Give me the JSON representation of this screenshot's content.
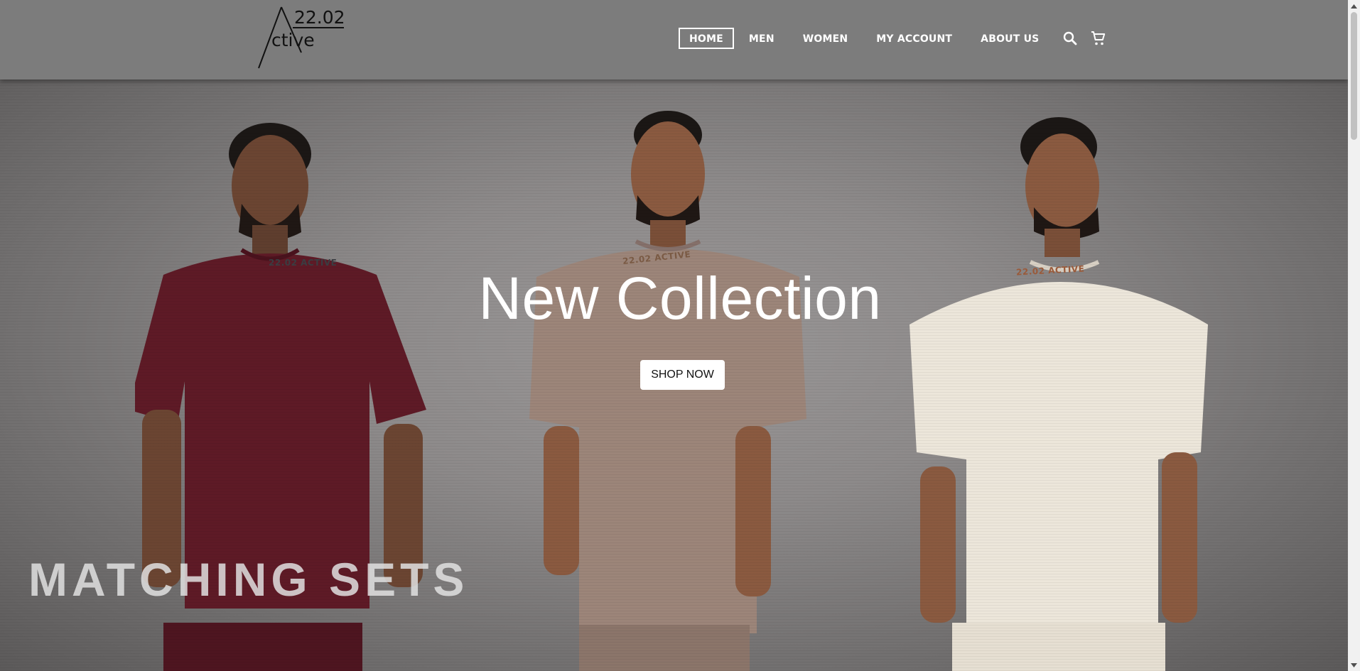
{
  "brand": {
    "logo_number": "22.02",
    "logo_word": "ctive"
  },
  "nav": {
    "items": [
      {
        "label": "HOME",
        "active": true
      },
      {
        "label": "MEN",
        "active": false
      },
      {
        "label": "WOMEN",
        "active": false
      },
      {
        "label": "MY ACCOUNT",
        "active": false
      },
      {
        "label": "ABOUT US",
        "active": false
      }
    ],
    "icons": [
      "search-icon",
      "cart-icon"
    ]
  },
  "hero": {
    "title": "New Collection",
    "button_label": "SHOP NOW",
    "shirt_prints": [
      "22.02 ACTIVE",
      "22.02 ACTIVE",
      "22.02 ACTIVE"
    ],
    "banner_text": "MATCHING SETS",
    "shirt_colors": [
      "#5e1a26",
      "#9c8579",
      "#ece6da"
    ]
  },
  "colors": {
    "header_bg": "#7c7c7c",
    "hero_bg": "#8f8c8c",
    "text_light": "#ffffff",
    "button_bg": "#ffffff"
  }
}
